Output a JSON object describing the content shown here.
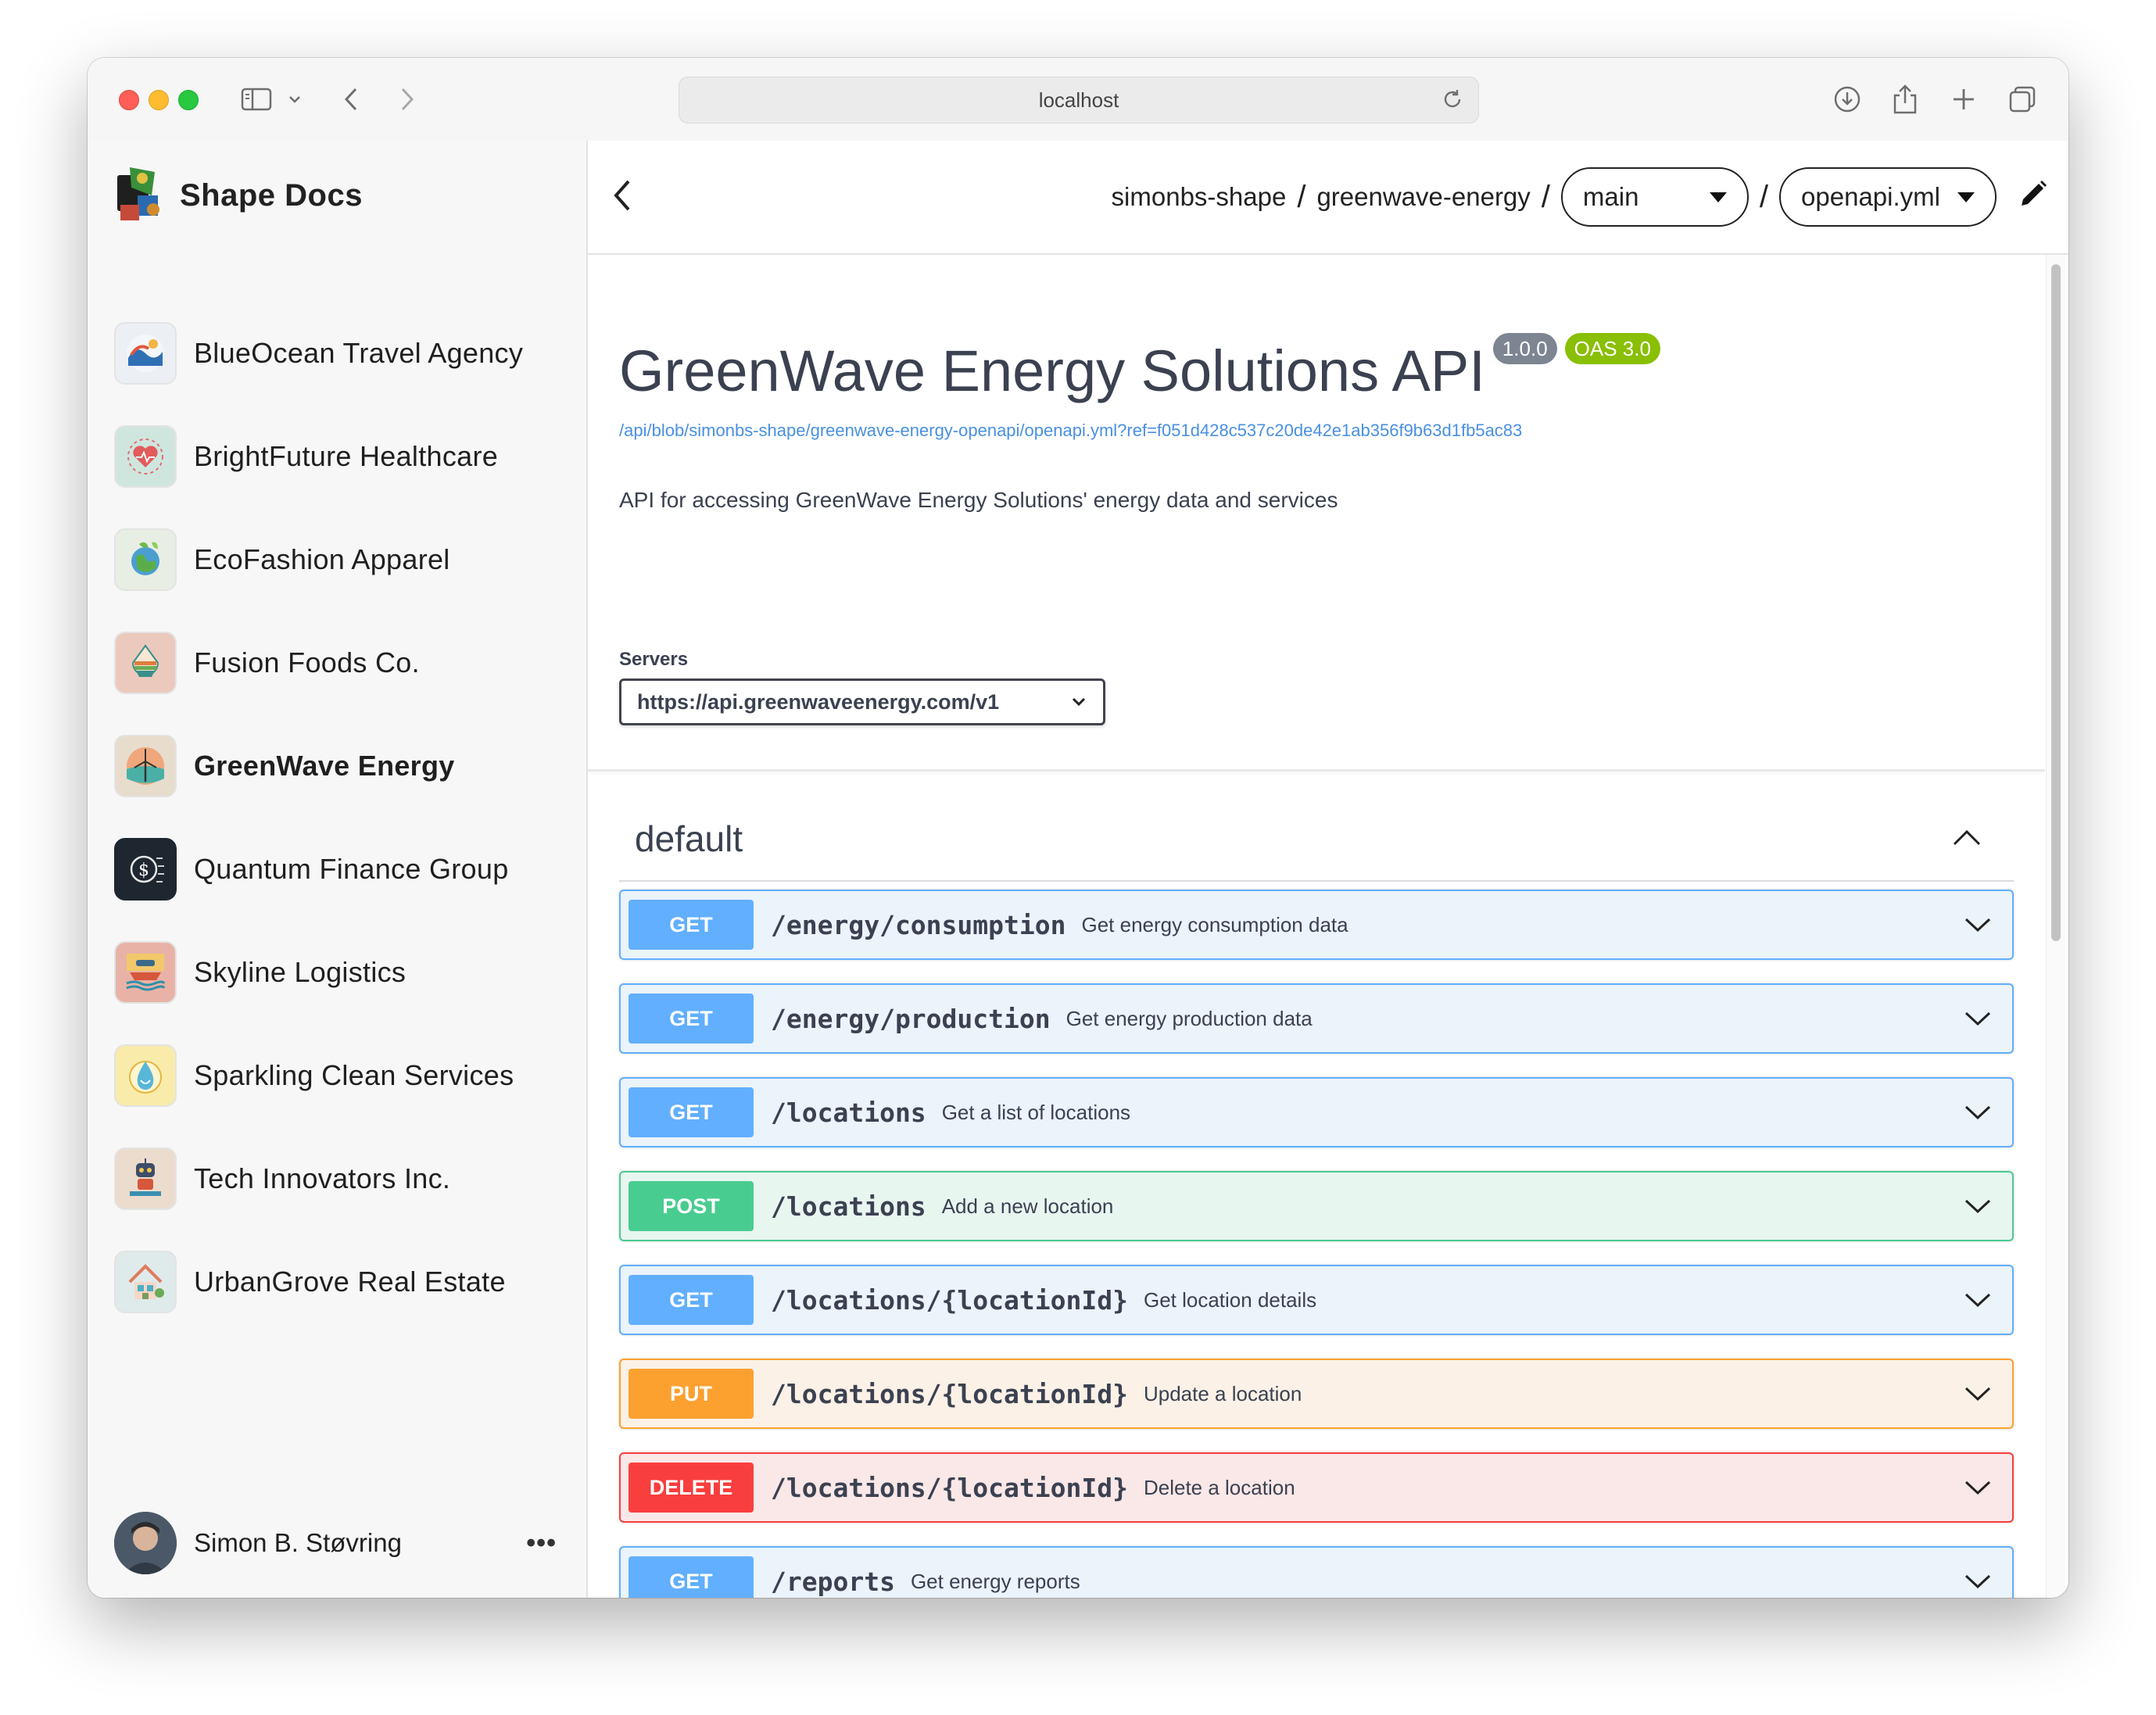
{
  "browser": {
    "url": "localhost"
  },
  "sidebar": {
    "brand": "Shape Docs",
    "items": [
      {
        "label": "BlueOcean Travel Agency",
        "icon": "ocean-wave-icon"
      },
      {
        "label": "BrightFuture Healthcare",
        "icon": "heart-health-icon"
      },
      {
        "label": "EcoFashion Apparel",
        "icon": "earth-leaf-icon"
      },
      {
        "label": "Fusion Foods Co.",
        "icon": "food-bowl-icon"
      },
      {
        "label": "GreenWave Energy",
        "icon": "wind-turbine-icon",
        "active": true
      },
      {
        "label": "Quantum Finance Group",
        "icon": "finance-chip-icon"
      },
      {
        "label": "Skyline Logistics",
        "icon": "ship-cargo-icon"
      },
      {
        "label": "Sparkling Clean Services",
        "icon": "water-drop-icon"
      },
      {
        "label": "Tech Innovators Inc.",
        "icon": "robot-icon"
      },
      {
        "label": "UrbanGrove Real Estate",
        "icon": "house-icon"
      }
    ],
    "user": {
      "name": "Simon B. Støvring",
      "menu_label": "•••"
    }
  },
  "header": {
    "org": "simonbs-shape",
    "sep1": "/",
    "project": "greenwave-energy",
    "sep2": "/",
    "branch": "main",
    "sep3": "/",
    "file": "openapi.yml"
  },
  "api": {
    "title": "GreenWave Energy Solutions API",
    "version": "1.0.0",
    "oas": "OAS 3.0",
    "spec_url": "/api/blob/simonbs-shape/greenwave-energy-openapi/openapi.yml?ref=f051d428c537c20de42e1ab356f9b63d1fb5ac83",
    "description": "API for accessing GreenWave Energy Solutions' energy data and services",
    "servers_label": "Servers",
    "server": "https://api.greenwaveenergy.com/v1"
  },
  "tag": {
    "name": "default"
  },
  "operations": [
    {
      "method": "GET",
      "path": "/energy/consumption",
      "summary": "Get energy consumption data"
    },
    {
      "method": "GET",
      "path": "/energy/production",
      "summary": "Get energy production data"
    },
    {
      "method": "GET",
      "path": "/locations",
      "summary": "Get a list of locations"
    },
    {
      "method": "POST",
      "path": "/locations",
      "summary": "Add a new location"
    },
    {
      "method": "GET",
      "path": "/locations/{locationId}",
      "summary": "Get location details"
    },
    {
      "method": "PUT",
      "path": "/locations/{locationId}",
      "summary": "Update a location"
    },
    {
      "method": "DELETE",
      "path": "/locations/{locationId}",
      "summary": "Delete a location"
    },
    {
      "method": "GET",
      "path": "/reports",
      "summary": "Get energy reports"
    }
  ],
  "colors": {
    "get": "#61affe",
    "post": "#49cc90",
    "put": "#fca130",
    "delete": "#f93e3e",
    "link": "#4990e2"
  }
}
